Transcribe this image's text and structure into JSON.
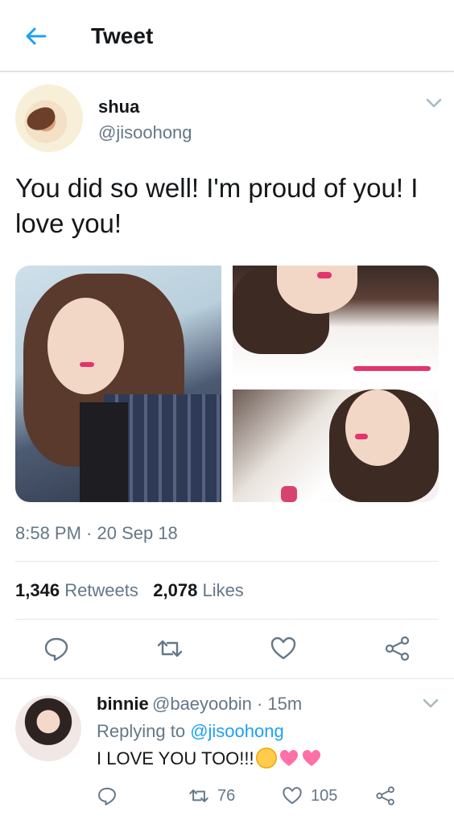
{
  "header": {
    "title": "Tweet",
    "accent": "#1da1f2"
  },
  "tweet": {
    "author_name": "shua",
    "author_handle": "@jisoohong",
    "text": "You did so well! I'm proud of you! I love you!",
    "timestamp": "8:58 PM · 20 Sep 18",
    "retweets_count": "1,346",
    "retweets_label": "Retweets",
    "likes_count": "2,078",
    "likes_label": "Likes",
    "actions": [
      "reply-icon",
      "retweet-icon",
      "heart-icon",
      "share-icon"
    ],
    "photos": [
      "photo-1",
      "photo-2",
      "photo-3"
    ]
  },
  "reply": {
    "name": "binnie",
    "handle_time": "@baeyoobin · 15m",
    "replying_prefix": "Replying to",
    "replying_handle": "@jisoohong",
    "text": "I LOVE YOU TOO!!!",
    "emojis": [
      "crying-face-icon",
      "heart-icon",
      "heart-icon"
    ],
    "retweets": "76",
    "likes": "105"
  },
  "colors": {
    "muted": "#657786",
    "text": "#14171a",
    "link": "#1da1f2",
    "divider": "#e1e8ed"
  }
}
